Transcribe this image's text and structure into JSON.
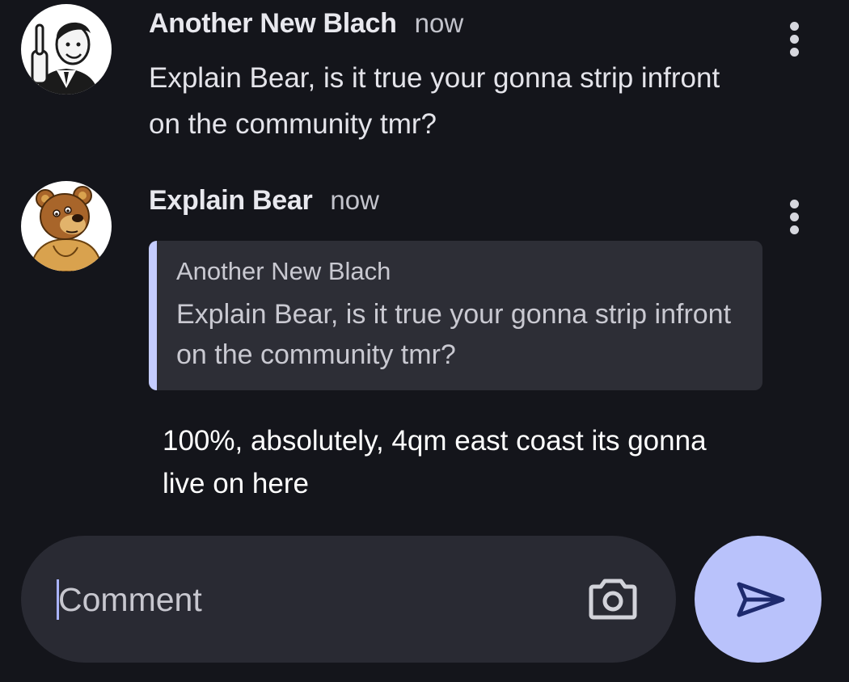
{
  "comments": [
    {
      "author": "Another New Blach",
      "time": "now",
      "text": "Explain Bear, is it true your gonna strip infront on the community tmr?",
      "avatar_icon": "retro-man-avatar"
    },
    {
      "author": "Explain Bear",
      "time": "now",
      "avatar_icon": "bear-avatar",
      "quoted": {
        "author": "Another New Blach",
        "text": "Explain Bear, is it true your gonna strip infront on the community tmr?"
      },
      "text": "100%, absolutely, 4qm east coast its gonna live on here"
    }
  ],
  "composer": {
    "placeholder": "Comment",
    "value": ""
  },
  "colors": {
    "background": "#14151b",
    "quote_background": "#2d2e36",
    "quote_accent": "#c4ccff",
    "composer_background": "#292a33",
    "send_button": "#b9c2fb",
    "send_icon": "#1e2a6e"
  },
  "icons": [
    "more-vert-icon",
    "camera-icon",
    "send-icon"
  ]
}
